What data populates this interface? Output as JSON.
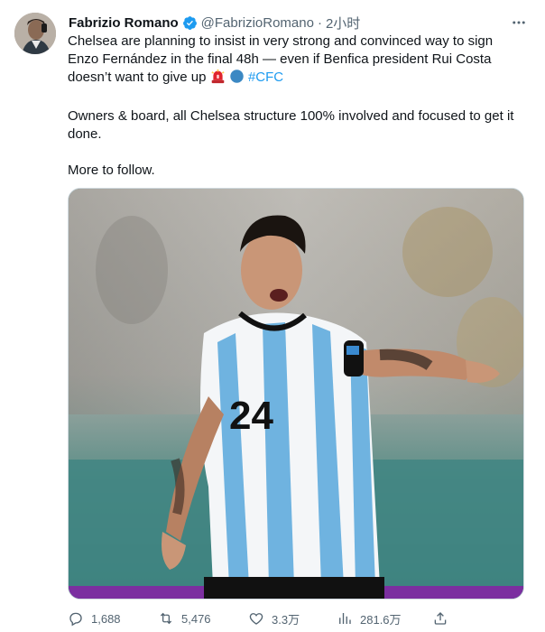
{
  "author": {
    "name": "Fabrizio Romano",
    "handle": "@FabrizioRomano",
    "separator": "·",
    "time": "2小时",
    "verified": true,
    "avatar_icon": "avatar-photo"
  },
  "tweet": {
    "line1": "Chelsea are planning to insist in very strong and convinced way to sign Enzo Fernández in the final 48h — even if Benfica president Rui Costa doesn’t want to give up",
    "emoji_1": "🚨",
    "emoji_2": "🔵",
    "hashtag": "#CFC",
    "paragraph2": "Owners & board, all Chelsea structure 100% involved and focused to get it done.",
    "paragraph3": "More to follow."
  },
  "media": {
    "description_icon": "football-player-photo",
    "jersey_number": "24"
  },
  "actions": {
    "replies": "1,688",
    "retweets": "5,476",
    "likes": "3.3万",
    "views": "281.6万"
  },
  "colors": {
    "link": "#1d9bf0",
    "secondary_text": "#536471",
    "primary_text": "#0f1419",
    "border": "#cfd9de"
  }
}
